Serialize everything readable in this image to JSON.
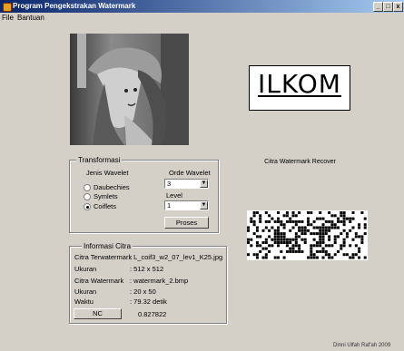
{
  "window": {
    "title": "Program Pengekstrakan Watermark",
    "buttons": {
      "minimize": "_",
      "maximize": "□",
      "close": "x"
    }
  },
  "menu": {
    "items": [
      "File",
      "Bantuan"
    ]
  },
  "host_image": {
    "icon": "grayscale-portrait-image"
  },
  "watermark_image": {
    "text": "ILKOM"
  },
  "recovered": {
    "label": "Citra Watermark Recover"
  },
  "transform": {
    "title": "Transformasi",
    "wavelet_header": "Jenis Wavelet",
    "options": [
      "Daubechies",
      "Symlets",
      "Coiflets"
    ],
    "selected": "Coiflets",
    "order_label": "Orde Wavelet",
    "order_value": "3",
    "level_label": "Level",
    "level_value": "1",
    "process_button": "Proses"
  },
  "info": {
    "title": "Informasi Citra",
    "rows": [
      {
        "label": "Citra Terwatermark",
        "value": ":  L_coif3_w2_07_lev1_K25.jpg"
      },
      {
        "label": "Ukuran",
        "value": ":  512  x  512"
      },
      {
        "label": "Citra Watermark",
        "value": ":  watermark_2.bmp"
      },
      {
        "label": "Ukuran",
        "value": ":  20   x   50"
      },
      {
        "label": "Waktu",
        "value": ":  79.32     detik"
      }
    ],
    "nc_button": "NC",
    "nc_value": "0.827822"
  },
  "footer": {
    "text": "Dinni Ulfah Raf'ah 2009"
  }
}
